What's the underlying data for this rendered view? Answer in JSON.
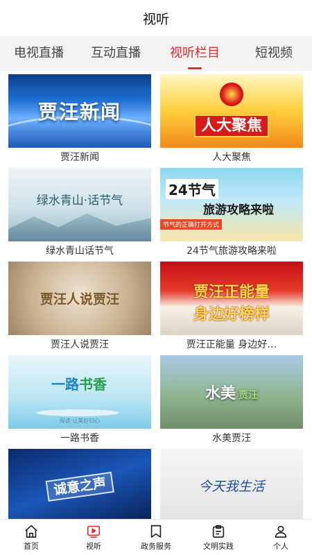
{
  "header": {
    "title": "视听"
  },
  "tabs": [
    {
      "label": "电视直播",
      "active": false
    },
    {
      "label": "互动直播",
      "active": false
    },
    {
      "label": "视听栏目",
      "active": true
    },
    {
      "label": "短视频",
      "active": false
    }
  ],
  "cards": [
    {
      "caption": "贾汪新闻",
      "thumb_text": "贾汪新闻"
    },
    {
      "caption": "人大聚焦",
      "thumb_text": "人大聚焦"
    },
    {
      "caption": "绿水青山话节气",
      "thumb_text": "绿水青山·话节气"
    },
    {
      "caption": "24节气旅游攻略来啦",
      "thumb_text_big": "24节气",
      "thumb_text_sub": "旅游攻略来啦",
      "thumb_tag": "节气的正确打开方式"
    },
    {
      "caption": "贾汪人说贾汪",
      "thumb_text": "贾汪人说贾汪"
    },
    {
      "caption": "贾汪正能量  身边好…",
      "thumb_line1": "贾汪正能量",
      "thumb_line2": "身边好榜样"
    },
    {
      "caption": "一路书香",
      "thumb_logo_a": "一路",
      "thumb_logo_b": "书香",
      "thumb_foot": "阅读·让美好归心"
    },
    {
      "caption": "水美贾汪",
      "thumb_text": "水美",
      "thumb_text_sub": "贾汪"
    },
    {
      "caption": "",
      "thumb_text": "诚意之声"
    },
    {
      "caption": "",
      "thumb_text": "今天我生活"
    }
  ],
  "nav": [
    {
      "label": "首页",
      "icon": "home-icon",
      "active": false
    },
    {
      "label": "视听",
      "icon": "video-icon",
      "active": true
    },
    {
      "label": "政务服务",
      "icon": "bookmark-icon",
      "active": false
    },
    {
      "label": "文明实践",
      "icon": "clipboard-icon",
      "active": false
    },
    {
      "label": "个人",
      "icon": "user-icon",
      "active": false
    }
  ],
  "colors": {
    "accent": "#e12a2a",
    "tab_bar_bg": "#f3f3f3"
  }
}
